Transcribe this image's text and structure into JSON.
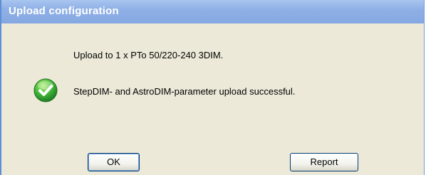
{
  "window": {
    "title": "Upload configuration"
  },
  "message": {
    "line1": "Upload to 1 x PTo 50/220-240 3DIM.",
    "line2": "StepDIM- and AstroDIM-parameter upload successful.",
    "icon": "success-check-icon"
  },
  "buttons": {
    "ok_label": "OK",
    "report_label": "Report"
  },
  "colors": {
    "titlebar": "#8fb0e6",
    "dialog_bg": "#ece9d8",
    "success_green": "#3cb043"
  }
}
